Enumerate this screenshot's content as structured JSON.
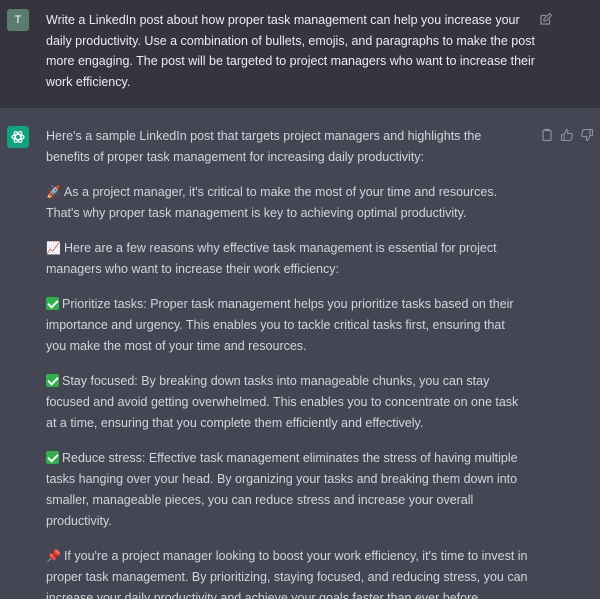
{
  "user": {
    "avatar_letter": "T",
    "message": "Write a LinkedIn post about how proper task management can help you increase your daily productivity. Use a combination of bullets, emojis, and paragraphs to make the post more engaging. The post will be targeted to project managers who want to increase their work efficiency.",
    "edit_icon": "edit-icon"
  },
  "assistant": {
    "avatar_icon": "openai-logo-icon",
    "actions": [
      "copy-icon",
      "thumbs-up-icon",
      "thumbs-down-icon"
    ],
    "intro": "Here's a sample LinkedIn post that targets project managers and highlights the benefits of proper task management for increasing daily productivity:",
    "p1_emoji": "🚀",
    "p1": "As a project manager, it's critical to make the most of your time and resources. That's why proper task management is key to achieving optimal productivity.",
    "p2_emoji": "📈",
    "p2": "Here are a few reasons why effective task management is essential for project managers who want to increase their work efficiency:",
    "bullets": [
      "Prioritize tasks: Proper task management helps you prioritize tasks based on their importance and urgency. This enables you to tackle critical tasks first, ensuring that you make the most of your time and resources.",
      "Stay focused: By breaking down tasks into manageable chunks, you can stay focused and avoid getting overwhelmed. This enables you to concentrate on one task at a time, ensuring that you complete them efficiently and effectively.",
      "Reduce stress: Effective task management eliminates the stress of having multiple tasks hanging over your head. By organizing your tasks and breaking them down into smaller, manageable pieces, you can reduce stress and increase your overall productivity."
    ],
    "closing_emoji": "📌",
    "closing": "If you're a project manager looking to boost your work efficiency, it's time to invest in proper task management. By prioritizing, staying focused, and reducing stress, you can increase your daily productivity and achieve your goals faster than ever before."
  },
  "colors": {
    "user_bg": "#343541",
    "assistant_bg": "#444654",
    "bot_avatar": "#10a37f",
    "check_green": "#2fb14a"
  }
}
